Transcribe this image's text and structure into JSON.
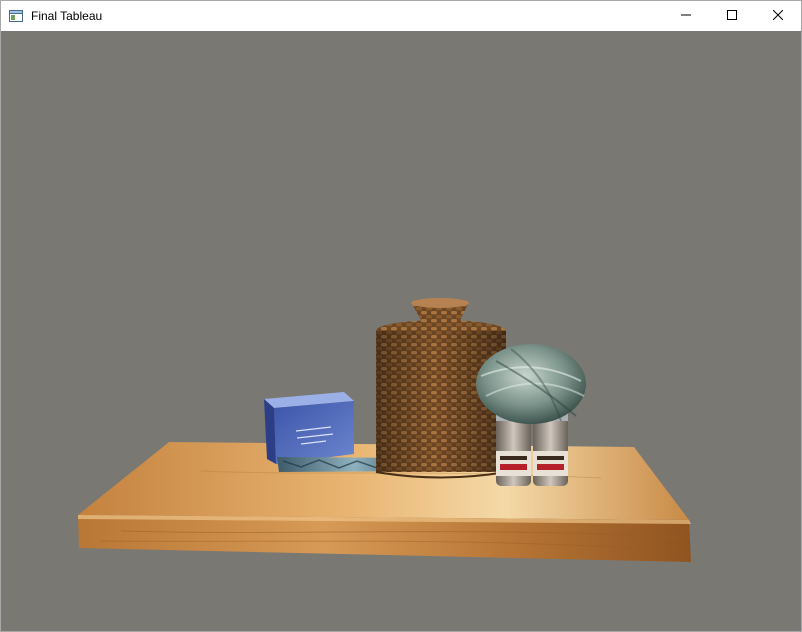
{
  "window": {
    "title": "Final Tableau",
    "icon": "app-window-icon",
    "controls": {
      "minimize_icon": "minimize-icon",
      "maximize_icon": "maximize-icon",
      "close_icon": "close-icon"
    }
  },
  "viewport": {
    "background_color": "#7a7873",
    "scene_objects": [
      "wooden-shelf",
      "blue-gift-box",
      "patterned-pen",
      "woven-basket-canister",
      "woven-basket-lid-knob",
      "spice-jar-left",
      "spice-jar-right",
      "green-yarn-ball"
    ]
  }
}
